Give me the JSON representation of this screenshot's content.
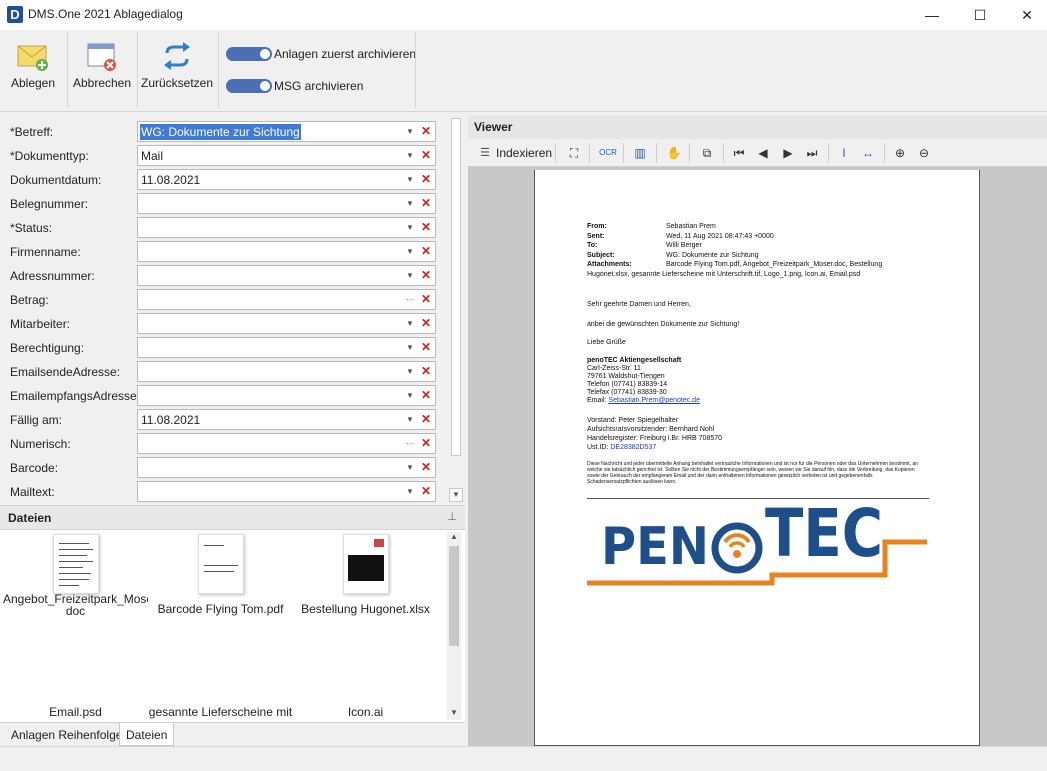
{
  "window": {
    "title": "DMS.One 2021 Ablagedialog",
    "app_icon": "D",
    "minimize": "—",
    "maximize": "☐",
    "close": "✕"
  },
  "ribbon": {
    "ablegen_label": "Ablegen",
    "abbrechen_label": "Abbrechen",
    "zuruecksetzen_label": "Zurücksetzen",
    "toggle_anlagen_label": "Anlagen zuerst archivieren",
    "toggle_msg_label": "MSG archivieren",
    "toggle_anlagen_on": true,
    "toggle_msg_on": true
  },
  "form": {
    "fields": [
      {
        "label": "*Betreff:",
        "value": "WG: Dokumente zur Sichtung",
        "selected": true,
        "button": "▼"
      },
      {
        "label": "*Dokumenttyp:",
        "value": "Mail",
        "button": "▼"
      },
      {
        "label": "Dokumentdatum:",
        "value": "11.08.2021",
        "button": "▼"
      },
      {
        "label": "Belegnummer:",
        "value": "",
        "button": "▼"
      },
      {
        "label": "*Status:",
        "value": "",
        "button": "▼"
      },
      {
        "label": "Firmenname:",
        "value": "",
        "button": "▼"
      },
      {
        "label": "Adressnummer:",
        "value": "",
        "button": "▼"
      },
      {
        "label": "Betrag:",
        "value": "",
        "button": "···"
      },
      {
        "label": "Mitarbeiter:",
        "value": "",
        "button": "▼"
      },
      {
        "label": "Berechtigung:",
        "value": "",
        "button": "▼"
      },
      {
        "label": "EmailsendeAdresse:",
        "value": "",
        "button": "▼"
      },
      {
        "label": "EmailempfangsAdresse:",
        "value": "",
        "button": "▼"
      },
      {
        "label": "Fällig am:",
        "value": "11.08.2021",
        "button": "▼"
      },
      {
        "label": "Numerisch:",
        "value": "",
        "button": "···"
      },
      {
        "label": "Barcode:",
        "value": "",
        "button": "▼"
      },
      {
        "label": "Mailtext:",
        "value": "",
        "button": "▼"
      }
    ],
    "clear_glyph": "✕"
  },
  "dateien": {
    "title": "Dateien",
    "pin_glyph": "📌",
    "files": [
      {
        "name": "Angebot_Freizeitpark_Moser.doc",
        "name_line2": "doc"
      },
      {
        "name": "Barcode Flying Tom.pdf"
      },
      {
        "name": "Bestellung Hugonet.xlsx"
      },
      {
        "name": "Email.psd"
      },
      {
        "name": "gesannte Lieferscheine mit"
      },
      {
        "name": "Icon.ai"
      }
    ],
    "tabs": [
      "Anlagen Reihenfolge",
      "Dateien"
    ]
  },
  "viewer": {
    "title": "Viewer",
    "indexieren_label": "Indexieren",
    "mail": {
      "from_label": "From:",
      "from": "Sebastian Prem",
      "sent_label": "Sent:",
      "sent": "Wed, 11 Aug 2021 08:47:43 +0000",
      "to_label": "To:",
      "to": "Willi Berger",
      "subject_label": "Subject:",
      "subject": "WG: Dokumente zur Sichtung",
      "attachments_label": "Attachments:",
      "attachments": "Barcode Flying Tom.pdf, Angebot_Freizeitpark_Moser.doc, Bestellung",
      "attachments2": "Hugonet.xlsx, gesannte Lieferscheine mit Unterschrift.tif, Logo_1.png, Icon.ai, Email.psd",
      "greeting": "Sehr geehrte Damen und Herren,",
      "body": "anbei die gewünschten Dokumente zur Sichtung!",
      "closing": "Liebe Grüße",
      "company": "penoTEC Aktiengesellschaft",
      "street": "Carl-Zeiss-Str. 11",
      "city": "79761 Waldshut-Tiengen",
      "phone": "Telefon (07741) 83839-14",
      "fax": "Telefax (07741) 83839-30",
      "email_label": "Email:",
      "email": "Sebastian.Prem@penotec.de",
      "board": "Vorstand: Peter Spiegelhalter",
      "chair": "Aufsichtsratsvorsitzender: Bernhard Nohl",
      "register": "Handelsregister: Freiburg i.Br. HRB 708570",
      "ustid_label": "Ust.ID:",
      "ustid": "DE28382D537",
      "disclaimer": "Diese Nachricht und jeder übermittelte Anhang beinhaltet vertrauliche Informationen und ist nur für die Personen oder das Unternehmen bestimmt, an welche sie tatsächlich gerichtet ist. Sollten Sie nicht der Bestimmungsempfänger sein, weisen wir Sie darauf hin, dass die Verbreitung, das Kopieren sowie der Gebrauch der empfangenen Email und der darin enthaltenen Informationen gesetzlich verboten ist und gegebenenfalls Schadensersatzpflichten auslösen kann."
    },
    "logo": {
      "left": "PEN",
      "right": "TEC",
      "blue": "#1f4f8b",
      "orange": "#e8831f"
    }
  }
}
